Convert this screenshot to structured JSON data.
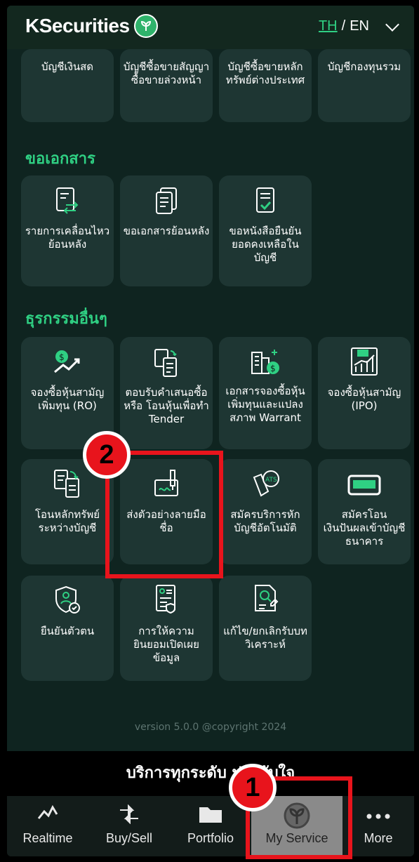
{
  "header": {
    "logo_text": "KSecurities",
    "lang_th": "TH",
    "lang_sep": " / ",
    "lang_en": "EN"
  },
  "top_cards": [
    {
      "label": "บัญชีเงินสด"
    },
    {
      "label": "บัญชีซื้อขายสัญญาซื้อขายล่วงหน้า"
    },
    {
      "label": "บัญชีซื้อขายหลักทรัพย์ต่างประเทศ"
    },
    {
      "label": "บัญชีกองทุนรวม"
    }
  ],
  "sections": {
    "documents": "ขอเอกสาร",
    "other": "ธุรกรรมอื่นๆ"
  },
  "document_cards": [
    {
      "label": "รายการเคลื่อนไหวย้อนหลัง",
      "icon": "statement-icon"
    },
    {
      "label": "ขอเอกสารย้อนหลัง",
      "icon": "documents-icon"
    },
    {
      "label": "ขอหนังสือยืนยันยอดคงเหลือในบัญชี",
      "icon": "certificate-icon"
    }
  ],
  "other_cards": [
    {
      "label": "จองซื้อหุ้นสามัญเพิ่มทุน (RO)",
      "icon": "rights-offering-icon"
    },
    {
      "label": "ตอบรับคำเสนอซื้อ หรือ โอนหุ้นเพื่อทำ Tender",
      "icon": "tender-icon"
    },
    {
      "label": "เอกสารจองซื้อหุ้นเพิ่มทุนและแปลงสภาพ Warrant",
      "icon": "warrant-icon"
    },
    {
      "label": "จองซื้อหุ้นสามัญ (IPO)",
      "icon": "ipo-icon"
    },
    {
      "label": "โอนหลักทรัพย์ระหว่างบัญชี",
      "icon": "transfer-icon"
    },
    {
      "label": "ส่งตัวอย่างลายมือชื่อ",
      "icon": "signature-icon"
    },
    {
      "label": "สมัครบริการหักบัญชีอัตโนมัติ",
      "icon": "ats-icon"
    },
    {
      "label": "สมัครโอนเงินปันผลเข้าบัญชีธนาคาร",
      "icon": "bank-card-icon"
    },
    {
      "label": "ยืนยันตัวตน",
      "icon": "identity-icon"
    },
    {
      "label": "การให้ความยินยอมเปิดเผยข้อมูล",
      "icon": "consent-icon"
    },
    {
      "label": "แก้ไข/ยกเลิกรับบทวิเคราะห์",
      "icon": "research-icon"
    }
  ],
  "version": "version 5.0.0 @copyright 2024",
  "banner": "บริการทุกระดับ ประทับใจ",
  "tabs": [
    {
      "label": "Realtime",
      "icon": "chart-line-icon"
    },
    {
      "label": "Buy/Sell",
      "icon": "buy-sell-arrows-icon"
    },
    {
      "label": "Portfolio",
      "icon": "folder-icon"
    },
    {
      "label": "My Service",
      "icon": "kbank-leaf-icon",
      "active": true
    },
    {
      "label": "More",
      "icon": "more-dots-icon"
    }
  ],
  "annotations": {
    "step1": "1",
    "step2": "2",
    "color": "#e8141c"
  }
}
